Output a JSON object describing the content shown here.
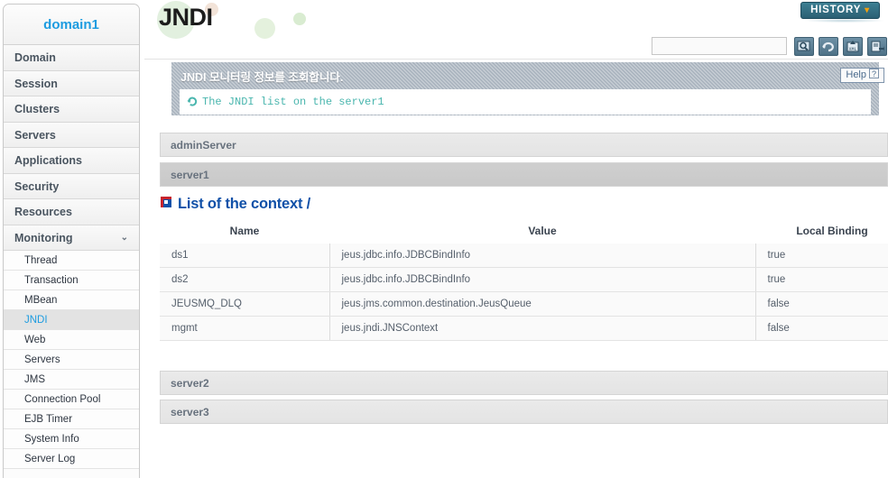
{
  "sidebar": {
    "domain_label": "domain1",
    "nav": [
      {
        "label": "Domain",
        "chevron": ""
      },
      {
        "label": "Session",
        "chevron": ""
      },
      {
        "label": "Clusters",
        "chevron": ""
      },
      {
        "label": "Servers",
        "chevron": ""
      },
      {
        "label": "Applications",
        "chevron": ""
      },
      {
        "label": "Security",
        "chevron": ""
      },
      {
        "label": "Resources",
        "chevron": ""
      },
      {
        "label": "Monitoring",
        "chevron": "⌄"
      }
    ],
    "submenu": [
      {
        "label": "Thread",
        "active": false
      },
      {
        "label": "Transaction",
        "active": false
      },
      {
        "label": "MBean",
        "active": false
      },
      {
        "label": "JNDI",
        "active": true
      },
      {
        "label": "Web",
        "active": false
      },
      {
        "label": "Servers",
        "active": false
      },
      {
        "label": "JMS",
        "active": false
      },
      {
        "label": "Connection Pool",
        "active": false
      },
      {
        "label": "EJB Timer",
        "active": false
      },
      {
        "label": "System Info",
        "active": false
      },
      {
        "label": "Server Log",
        "active": false
      }
    ]
  },
  "header": {
    "page_title": "JNDI",
    "history_label": "HISTORY",
    "history_caret": "▾",
    "search_value": "",
    "search_placeholder": "",
    "tools": [
      {
        "name": "search-icon",
        "label": "Search"
      },
      {
        "name": "refresh-icon",
        "label": "Refresh"
      },
      {
        "name": "xml-export-icon",
        "label": "XML"
      },
      {
        "name": "export-icon",
        "label": "Export"
      }
    ]
  },
  "banner": {
    "title": "JNDI 모니터링 정보를 조회합니다.",
    "message": "The JNDI list on the server1",
    "help_label": "Help",
    "help_mark": "?"
  },
  "servers": {
    "admin": "adminServer",
    "server1": "server1",
    "server2": "server2",
    "server3": "server3"
  },
  "section": {
    "title": "List of the context /"
  },
  "table": {
    "columns": [
      "Name",
      "Value",
      "Local Binding"
    ],
    "rows": [
      {
        "name": "ds1",
        "value": "jeus.jdbc.info.JDBCBindInfo",
        "binding": "true"
      },
      {
        "name": "ds2",
        "value": "jeus.jdbc.info.JDBCBindInfo",
        "binding": "true"
      },
      {
        "name": "JEUSMQ_DLQ",
        "value": "jeus.jms.common.destination.JeusQueue",
        "binding": "false"
      },
      {
        "name": "mgmt",
        "value": "jeus.jndi.JNSContext",
        "binding": "false"
      }
    ]
  },
  "colors": {
    "accent_blue": "#1d9ce0",
    "section_blue": "#1151a8",
    "teal": "#4ab6ae",
    "history_bg": "#2b5f74",
    "caret_orange": "#f2a00e"
  }
}
